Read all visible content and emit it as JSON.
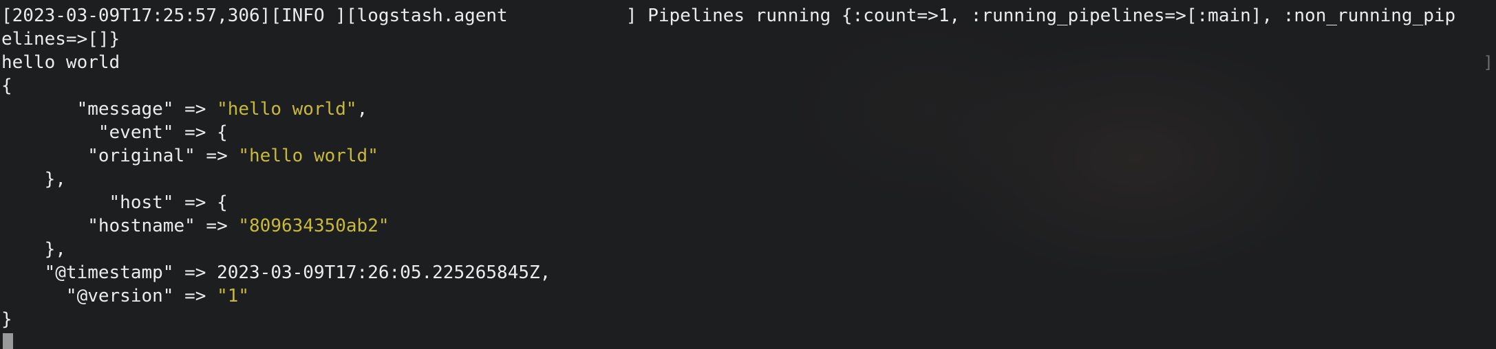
{
  "log": {
    "line1": "[2023-03-09T17:25:57,306][INFO ][logstash.agent           ] Pipelines running {:count=>1, :running_pipelines=>[:main], :non_running_pip",
    "line2": "elines=>[]}"
  },
  "input_echo": "hello world",
  "output": {
    "open_brace": "{",
    "message_key": "       \"message\" => ",
    "message_value": "\"hello world\"",
    "message_tail": ",",
    "event_key": "         \"event\" => {",
    "original_key": "        \"original\" => ",
    "original_value": "\"hello world\"",
    "event_close": "    },",
    "host_key": "          \"host\" => {",
    "hostname_key": "        \"hostname\" => ",
    "hostname_value": "\"809634350ab2\"",
    "host_close": "    },",
    "timestamp_line": "    \"@timestamp\" => 2023-03-09T17:26:05.225265845Z,",
    "version_key": "      \"@version\" => ",
    "version_value": "\"1\"",
    "close_brace": "}"
  },
  "right_edge_glyph": "]"
}
